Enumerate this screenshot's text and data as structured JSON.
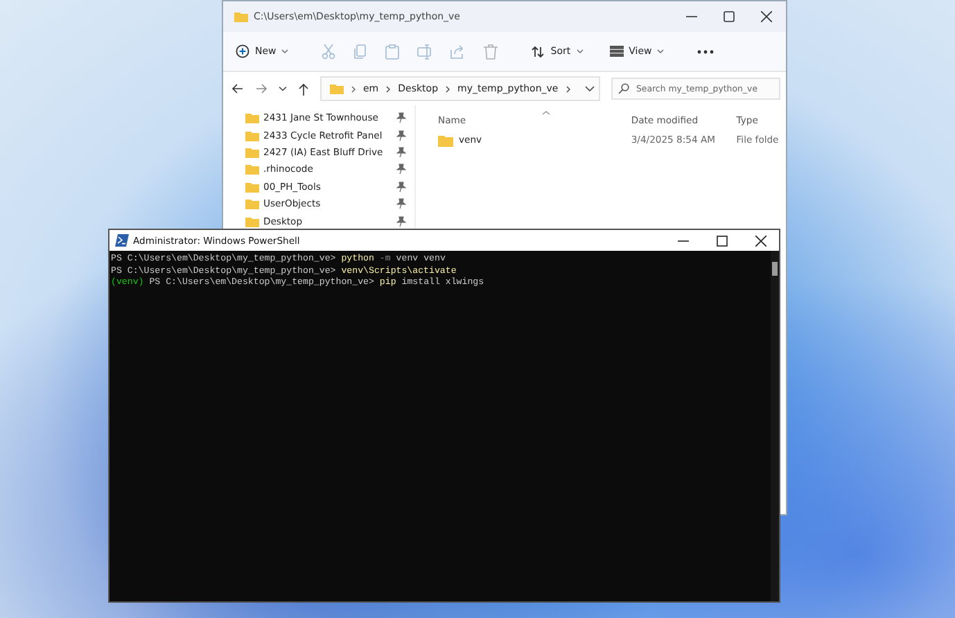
{
  "explorer": {
    "title": "C:\\Users\\em\\Desktop\\my_temp_python_ve",
    "toolbar": [
      {
        "kind": "new",
        "label": "New",
        "disabled": false
      },
      {
        "kind": "cut",
        "disabled": true
      },
      {
        "kind": "copy",
        "disabled": true
      },
      {
        "kind": "paste",
        "disabled": true
      },
      {
        "kind": "rename",
        "disabled": true
      },
      {
        "kind": "share",
        "disabled": true
      },
      {
        "kind": "delete",
        "disabled": true
      },
      {
        "kind": "sort",
        "label": "Sort",
        "disabled": false
      },
      {
        "kind": "view",
        "label": "View",
        "disabled": false
      },
      {
        "kind": "more",
        "disabled": false
      }
    ],
    "address": [
      "em",
      "Desktop",
      "my_temp_python_ve"
    ],
    "search": {
      "placeholder": "Search my_temp_python_ve"
    },
    "quick_access": [
      {
        "label": "2431 Jane St Townhouse",
        "pinned": true
      },
      {
        "label": "2433 Cycle Retrofit Panel",
        "pinned": true
      },
      {
        "label": "2427 (IA) East Bluff Drive",
        "pinned": true
      },
      {
        "label": ".rhinocode",
        "pinned": true
      },
      {
        "label": "00_PH_Tools",
        "pinned": true
      },
      {
        "label": "UserObjects",
        "pinned": true
      },
      {
        "label": "Desktop",
        "pinned": true
      }
    ],
    "columns": [
      "Name",
      "Date modified",
      "Type"
    ],
    "rows": [
      {
        "name": "venv",
        "date": "3/4/2025 8:54 AM",
        "type": "File folde"
      }
    ]
  },
  "terminal": {
    "title": "Administrator: Windows PowerShell",
    "lines": [
      {
        "segments": [
          {
            "kind": "prompt",
            "text": "PS C:\\Users\\em\\Desktop\\my_temp_python_ve> "
          },
          {
            "kind": "command",
            "text": "python"
          },
          {
            "kind": "param",
            "text": " -m"
          },
          {
            "kind": "arg",
            "text": " venv venv"
          }
        ]
      },
      {
        "segments": [
          {
            "kind": "prompt",
            "text": "PS C:\\Users\\em\\Desktop\\my_temp_python_ve> "
          },
          {
            "kind": "command",
            "text": "venv\\Scripts\\activate"
          }
        ]
      },
      {
        "segments": [
          {
            "kind": "venv",
            "text": "(venv)"
          },
          {
            "kind": "prompt",
            "text": " PS C:\\Users\\em\\Desktop\\my_temp_python_ve> "
          },
          {
            "kind": "command",
            "text": "pip"
          },
          {
            "kind": "arg",
            "text": " imstall xlwings"
          }
        ]
      }
    ]
  }
}
